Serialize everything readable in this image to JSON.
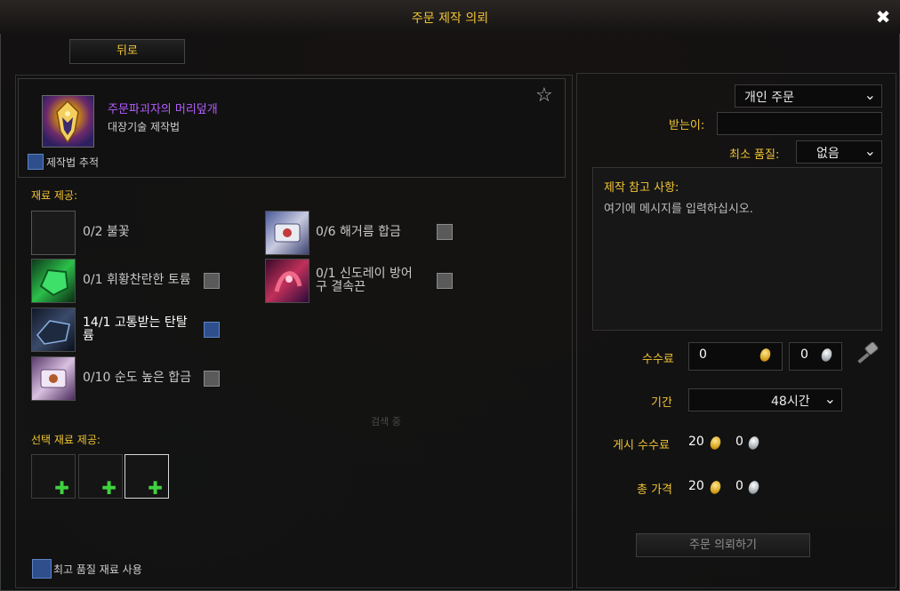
{
  "window": {
    "title": "주문 제작 의뢰",
    "close_glyph": "✖",
    "back_label": "뒤로"
  },
  "recipe": {
    "name": "주문파괴자의 머리덮개",
    "type": "대장기술 제작법",
    "track_label": "제작법 추적",
    "icon": "helm-icon",
    "favorite_icon": "star-icon"
  },
  "reagents": {
    "header": "재료 제공:",
    "items": [
      {
        "text": "0/2 불꽃",
        "icon": "empty-slot",
        "checkbox": false
      },
      {
        "text": "0/6 해거름 합금",
        "icon": "alloy-icon",
        "checkbox": "gray"
      },
      {
        "text": "0/1 휘황찬란한 토륨",
        "icon": "thorium-ore-icon",
        "checkbox": "gray"
      },
      {
        "text": "0/1 신도레이 방어구 결속끈",
        "icon": "armor-binding-icon",
        "checkbox": "gray"
      },
      {
        "text": "14/1 고통받는 탄탈륨",
        "icon": "tantalum-icon",
        "checkbox": "blue"
      },
      {
        "text": "0/10 순도 높은 합금",
        "icon": "pure-alloy-icon",
        "checkbox": "gray"
      }
    ]
  },
  "optional_reagents": {
    "header": "선택 재료 제공:",
    "plus": "✚"
  },
  "best_quality_label": "최고 품질 재료 사용",
  "faint_text": "검색 중",
  "order": {
    "type_value": "개인 주문",
    "recipient_label": "받는이:",
    "recipient_value": "",
    "min_quality_label": "최소 품질:",
    "min_quality_value": "없음",
    "notes_title": "제작 참고 사항:",
    "notes_placeholder": "여기에 메시지를 입력하십시오.",
    "commission_label": "수수료",
    "commission_gold": "0",
    "commission_silver": "0",
    "duration_label": "기간",
    "duration_value": "48시간",
    "posting_fee_label": "게시 수수료",
    "posting_fee_gold": "20",
    "posting_fee_silver": "0",
    "total_label": "총 가격",
    "total_gold": "20",
    "total_silver": "0",
    "submit_label": "주문 의뢰하기"
  },
  "colors": {
    "accent_yellow": "#f1c433",
    "epic_purple": "#b55eff",
    "plus_green": "#3fd23f"
  }
}
